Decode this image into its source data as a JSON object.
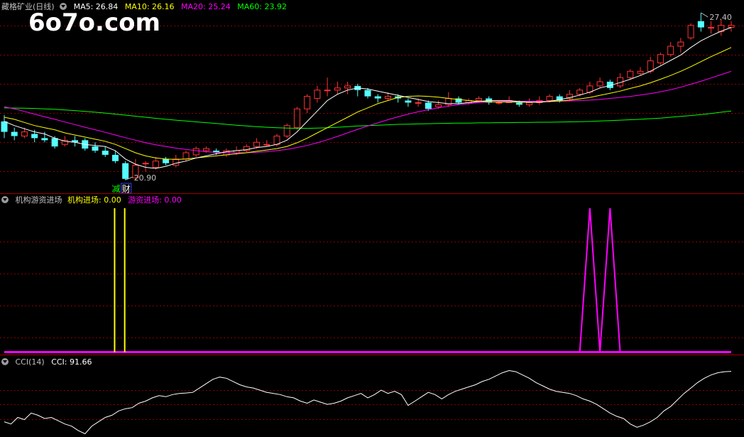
{
  "main_panel": {
    "stock_name": "藏格矿业(日线)",
    "ma_labels": [
      {
        "text": "MA5: 26.84",
        "color": "#ffffff"
      },
      {
        "text": "MA10: 26.16",
        "color": "#ffff00"
      },
      {
        "text": "MA20: 25.24",
        "color": "#ff00ff"
      },
      {
        "text": "MA60: 23.92",
        "color": "#00ff00"
      }
    ],
    "watermark": "6o7o.com",
    "high_label": "27.40",
    "low_label": "20.90",
    "marker_jian": "减",
    "marker_cai": "财"
  },
  "indicator_panel": {
    "title": "机构游资进场",
    "label_a": "机构进场: 0.00",
    "label_b": "游资进场: 0.00",
    "color_a": "#ffff00",
    "color_b": "#ff00ff"
  },
  "cci_panel": {
    "title": "CCI(14)",
    "label": "CCI: 91.66"
  },
  "colors": {
    "up": "#ff3232",
    "down": "#54ffff",
    "grid": "#8b0000",
    "ma5": "#ffffff",
    "ma10": "#ffff00",
    "ma20": "#ff00ff",
    "ma60": "#00ff00",
    "cci": "#ffffff"
  },
  "chart_data": {
    "type": "candlestick",
    "ohlc": [
      [
        23.7,
        23.2,
        24.0,
        22.9
      ],
      [
        23.2,
        23.0,
        23.4,
        22.8
      ],
      [
        23.0,
        23.2,
        23.4,
        22.9
      ],
      [
        23.1,
        22.9,
        23.3,
        22.7
      ],
      [
        22.9,
        22.8,
        23.2,
        22.7
      ],
      [
        22.9,
        22.5,
        23.0,
        22.4
      ],
      [
        22.6,
        22.8,
        23.0,
        22.5
      ],
      [
        22.8,
        22.7,
        23.0,
        22.5
      ],
      [
        22.8,
        22.4,
        22.9,
        22.3
      ],
      [
        22.5,
        22.3,
        22.7,
        22.2
      ],
      [
        22.3,
        22.1,
        22.5,
        22.0
      ],
      [
        22.1,
        21.8,
        22.3,
        21.7
      ],
      [
        21.7,
        20.95,
        21.8,
        20.9
      ],
      [
        21.0,
        21.6,
        21.9,
        20.9
      ],
      [
        21.7,
        21.7,
        21.8,
        21.3
      ],
      [
        21.5,
        21.8,
        22.0,
        21.4
      ],
      [
        21.9,
        21.7,
        22.0,
        21.6
      ],
      [
        21.6,
        21.9,
        22.1,
        21.5
      ],
      [
        21.9,
        22.2,
        22.3,
        21.8
      ],
      [
        22.1,
        22.4,
        22.5,
        22.0
      ],
      [
        22.3,
        22.4,
        22.5,
        22.2
      ],
      [
        22.3,
        22.2,
        22.4,
        22.1
      ],
      [
        22.1,
        22.3,
        22.4,
        22.0
      ],
      [
        22.2,
        22.3,
        22.5,
        22.1
      ],
      [
        22.3,
        22.5,
        22.6,
        22.2
      ],
      [
        22.5,
        22.7,
        22.9,
        22.4
      ],
      [
        22.6,
        22.6,
        22.8,
        22.5
      ],
      [
        22.6,
        23.0,
        23.1,
        22.5
      ],
      [
        23.0,
        23.5,
        23.6,
        22.9
      ],
      [
        23.4,
        24.3,
        24.4,
        23.3
      ],
      [
        24.3,
        24.9,
        25.0,
        24.1
      ],
      [
        24.8,
        25.2,
        25.4,
        24.6
      ],
      [
        25.2,
        25.2,
        25.8,
        24.9
      ],
      [
        25.2,
        25.3,
        25.6,
        25.0
      ],
      [
        25.3,
        25.4,
        25.6,
        25.0
      ],
      [
        25.4,
        25.2,
        25.5,
        24.9
      ],
      [
        25.2,
        24.9,
        25.3,
        24.8
      ],
      [
        24.9,
        24.8,
        25.0,
        24.6
      ],
      [
        24.8,
        24.9,
        25.1,
        24.7
      ],
      [
        24.9,
        24.8,
        25.0,
        24.6
      ],
      [
        24.7,
        24.6,
        24.8,
        24.4
      ],
      [
        24.6,
        24.6,
        24.8,
        24.4
      ],
      [
        24.6,
        24.3,
        24.7,
        24.2
      ],
      [
        24.4,
        24.5,
        24.7,
        24.3
      ],
      [
        24.5,
        24.8,
        25.1,
        24.4
      ],
      [
        24.8,
        24.6,
        24.9,
        24.5
      ],
      [
        24.6,
        24.7,
        24.8,
        24.5
      ],
      [
        24.7,
        24.8,
        24.9,
        24.6
      ],
      [
        24.8,
        24.6,
        24.9,
        24.5
      ],
      [
        24.6,
        24.6,
        24.7,
        24.5
      ],
      [
        24.6,
        24.7,
        24.9,
        24.6
      ],
      [
        24.6,
        24.5,
        24.7,
        24.4
      ],
      [
        24.5,
        24.6,
        24.8,
        24.4
      ],
      [
        24.6,
        24.7,
        24.9,
        24.5
      ],
      [
        24.7,
        24.9,
        25.0,
        24.6
      ],
      [
        24.9,
        24.7,
        25.0,
        24.6
      ],
      [
        24.8,
        25.0,
        25.2,
        24.7
      ],
      [
        25.0,
        25.2,
        25.3,
        24.9
      ],
      [
        25.1,
        25.4,
        25.6,
        25.0
      ],
      [
        25.4,
        25.6,
        25.8,
        25.3
      ],
      [
        25.6,
        25.3,
        25.7,
        25.2
      ],
      [
        25.4,
        25.8,
        26.0,
        25.3
      ],
      [
        25.8,
        26.1,
        26.2,
        25.7
      ],
      [
        26.0,
        26.1,
        26.3,
        25.9
      ],
      [
        26.1,
        26.6,
        26.8,
        26.0
      ],
      [
        26.5,
        26.9,
        27.0,
        26.4
      ],
      [
        26.9,
        27.3,
        27.5,
        26.8
      ],
      [
        27.3,
        27.5,
        27.7,
        27.0
      ],
      [
        27.7,
        28.3,
        28.4,
        27.6
      ],
      [
        28.5,
        28.2,
        28.9,
        28.0
      ],
      [
        28.2,
        28.2,
        28.5,
        27.9
      ],
      [
        28.0,
        28.3,
        28.6,
        27.8
      ],
      [
        28.2,
        28.3,
        28.5,
        28.0
      ]
    ],
    "ma5": [
      23.7,
      23.5,
      23.35,
      23.2,
      23.1,
      22.9,
      22.75,
      22.7,
      22.6,
      22.55,
      22.5,
      22.3,
      21.9,
      21.65,
      21.5,
      21.45,
      21.55,
      21.7,
      21.8,
      21.95,
      22.05,
      22.15,
      22.25,
      22.3,
      22.35,
      22.45,
      22.5,
      22.6,
      22.8,
      23.2,
      23.7,
      24.2,
      24.7,
      25.0,
      25.2,
      25.3,
      25.25,
      25.15,
      25.05,
      24.95,
      24.85,
      24.75,
      24.65,
      24.6,
      24.55,
      24.55,
      24.6,
      24.65,
      24.7,
      24.7,
      24.7,
      24.65,
      24.62,
      24.62,
      24.66,
      24.74,
      24.84,
      24.96,
      25.1,
      25.3,
      25.42,
      25.56,
      25.72,
      25.9,
      26.1,
      26.36,
      26.62,
      26.88,
      27.24,
      27.56,
      27.8,
      28.02,
      28.2
    ],
    "ma10": [
      23.9,
      23.8,
      23.65,
      23.5,
      23.4,
      23.3,
      23.15,
      23.05,
      22.95,
      22.85,
      22.75,
      22.6,
      22.4,
      22.2,
      22.05,
      21.95,
      21.9,
      21.88,
      21.9,
      21.95,
      22.0,
      22.05,
      22.1,
      22.15,
      22.2,
      22.27,
      22.33,
      22.4,
      22.5,
      22.68,
      22.9,
      23.15,
      23.4,
      23.65,
      23.9,
      24.15,
      24.35,
      24.55,
      24.7,
      24.85,
      24.9,
      24.92,
      24.9,
      24.86,
      24.8,
      24.75,
      24.7,
      24.66,
      24.64,
      24.63,
      24.63,
      24.62,
      24.62,
      24.63,
      24.65,
      24.68,
      24.72,
      24.78,
      24.85,
      24.95,
      25.05,
      25.15,
      25.28,
      25.4,
      25.55,
      25.72,
      25.9,
      26.1,
      26.32,
      26.56,
      26.8,
      27.02,
      27.24
    ],
    "ma20": [
      24.4,
      24.3,
      24.18,
      24.05,
      23.92,
      23.8,
      23.67,
      23.55,
      23.42,
      23.3,
      23.18,
      23.05,
      22.92,
      22.8,
      22.68,
      22.58,
      22.5,
      22.42,
      22.36,
      22.3,
      22.25,
      22.22,
      22.2,
      22.2,
      22.2,
      22.22,
      22.25,
      22.3,
      22.36,
      22.45,
      22.55,
      22.68,
      22.82,
      22.98,
      23.15,
      23.32,
      23.48,
      23.63,
      23.78,
      23.92,
      24.05,
      24.16,
      24.26,
      24.35,
      24.43,
      24.5,
      24.55,
      24.6,
      24.63,
      24.65,
      24.66,
      24.66,
      24.66,
      24.66,
      24.66,
      24.67,
      24.68,
      24.7,
      24.72,
      24.75,
      24.8,
      24.85,
      24.9,
      24.96,
      25.03,
      25.12,
      25.22,
      25.34,
      25.48,
      25.62,
      25.78,
      25.94,
      26.1
    ],
    "ma60": [
      24.35,
      24.34,
      24.33,
      24.32,
      24.3,
      24.28,
      24.25,
      24.22,
      24.18,
      24.14,
      24.1,
      24.05,
      24.0,
      23.95,
      23.9,
      23.85,
      23.8,
      23.76,
      23.72,
      23.68,
      23.64,
      23.6,
      23.56,
      23.52,
      23.48,
      23.45,
      23.42,
      23.4,
      23.38,
      23.37,
      23.37,
      23.38,
      23.4,
      23.42,
      23.45,
      23.48,
      23.5,
      23.52,
      23.54,
      23.56,
      23.57,
      23.58,
      23.59,
      23.6,
      23.61,
      23.62,
      23.62,
      23.63,
      23.63,
      23.64,
      23.64,
      23.65,
      23.65,
      23.66,
      23.66,
      23.67,
      23.68,
      23.69,
      23.7,
      23.72,
      23.74,
      23.76,
      23.78,
      23.8,
      23.83,
      23.86,
      23.9,
      23.94,
      23.98,
      24.03,
      24.08,
      24.14,
      24.2
    ],
    "y_range": [
      20.6,
      28.9
    ],
    "inst_signal_bars": [
      11,
      12
    ],
    "youzi_signal_bars": [
      58,
      60
    ],
    "cci": [
      -140,
      -150,
      -120,
      -130,
      -100,
      -110,
      -125,
      -120,
      -135,
      -150,
      -160,
      -180,
      -195,
      -160,
      -140,
      -120,
      -110,
      -90,
      -80,
      -75,
      -55,
      -45,
      -30,
      -20,
      -25,
      -15,
      -10,
      -8,
      -5,
      15,
      35,
      55,
      65,
      60,
      45,
      30,
      20,
      15,
      5,
      -5,
      -10,
      -15,
      -25,
      -30,
      -45,
      -55,
      -40,
      -50,
      -60,
      -55,
      -45,
      -30,
      -20,
      -10,
      -30,
      -15,
      5,
      -10,
      0,
      -15,
      -65,
      -45,
      -25,
      -5,
      -15,
      -35,
      -15,
      0,
      10,
      20,
      30,
      45,
      55,
      70,
      85,
      95,
      90,
      75,
      60,
      40,
      25,
      10,
      0,
      -5,
      -10,
      -20,
      -35,
      -45,
      -60,
      -80,
      -100,
      -115,
      -125,
      -150,
      -165,
      -155,
      -140,
      -120,
      -90,
      -70,
      -40,
      -10,
      15,
      40,
      60,
      75,
      85,
      90,
      91.66
    ]
  }
}
